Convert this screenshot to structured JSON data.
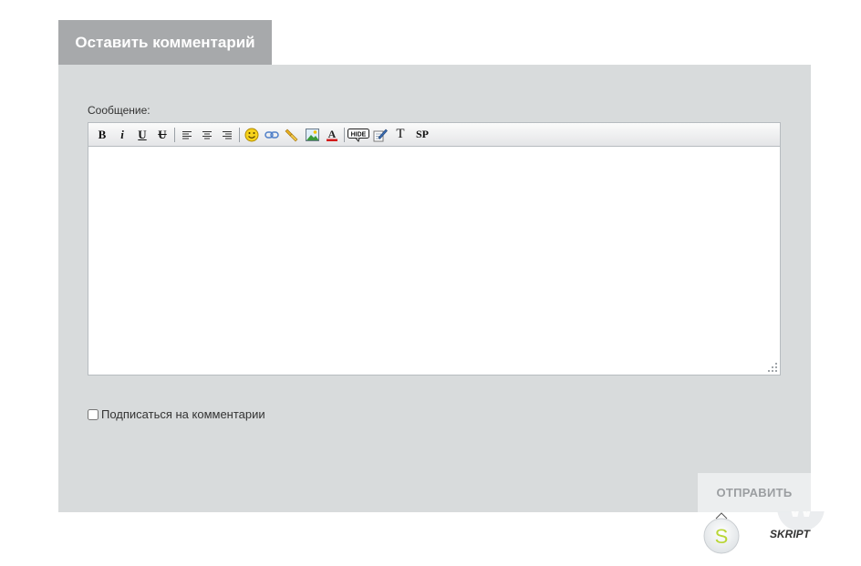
{
  "form": {
    "title": "Оставить комментарий",
    "message_label": "Сообщение:",
    "subscribe_label": "Подписаться на комментарии",
    "subscribe_checked": false,
    "submit_label": "ОТПРАВИТЬ"
  },
  "toolbar": {
    "bold": "B",
    "italic": "i",
    "underline": "U",
    "strike": "U",
    "text_type": "T",
    "spoiler": "SP",
    "hide_label": "HIDE",
    "icons": [
      "align-left-icon",
      "align-center-icon",
      "align-right-icon",
      "smiley-icon",
      "link-icon",
      "quote-icon",
      "image-icon",
      "text-color-icon",
      "hide-icon",
      "edit-icon"
    ]
  },
  "watermark": {
    "text": "SKRIPT"
  },
  "colors": {
    "tab_bg": "#a7a9ab",
    "panel_bg": "#d8dbdc",
    "button_bg": "#eceeef"
  }
}
